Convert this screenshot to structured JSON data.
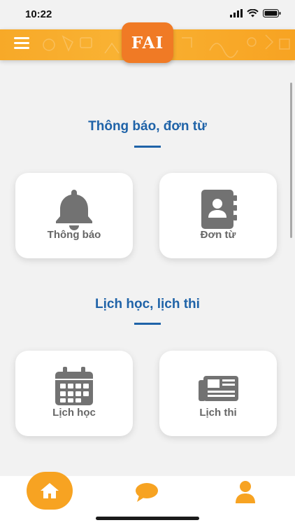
{
  "status_bar": {
    "time": "10:22"
  },
  "header": {
    "logo_text": "FAI"
  },
  "sections": [
    {
      "title": "Thông báo, đơn từ",
      "cards": [
        {
          "label": "Thông báo",
          "icon": "bell-icon"
        },
        {
          "label": "Đơn từ",
          "icon": "contact-book-icon"
        }
      ]
    },
    {
      "title": "Lịch học, lịch thi",
      "cards": [
        {
          "label": "Lịch học",
          "icon": "calendar-icon"
        },
        {
          "label": "Lịch thi",
          "icon": "newspaper-icon"
        }
      ]
    }
  ],
  "bottom_nav": {
    "items": [
      "home-icon",
      "chat-icon",
      "profile-icon"
    ]
  },
  "colors": {
    "accent": "#f7a322",
    "logo": "#f07a25",
    "title": "#1f63a8",
    "icon": "#727272"
  }
}
